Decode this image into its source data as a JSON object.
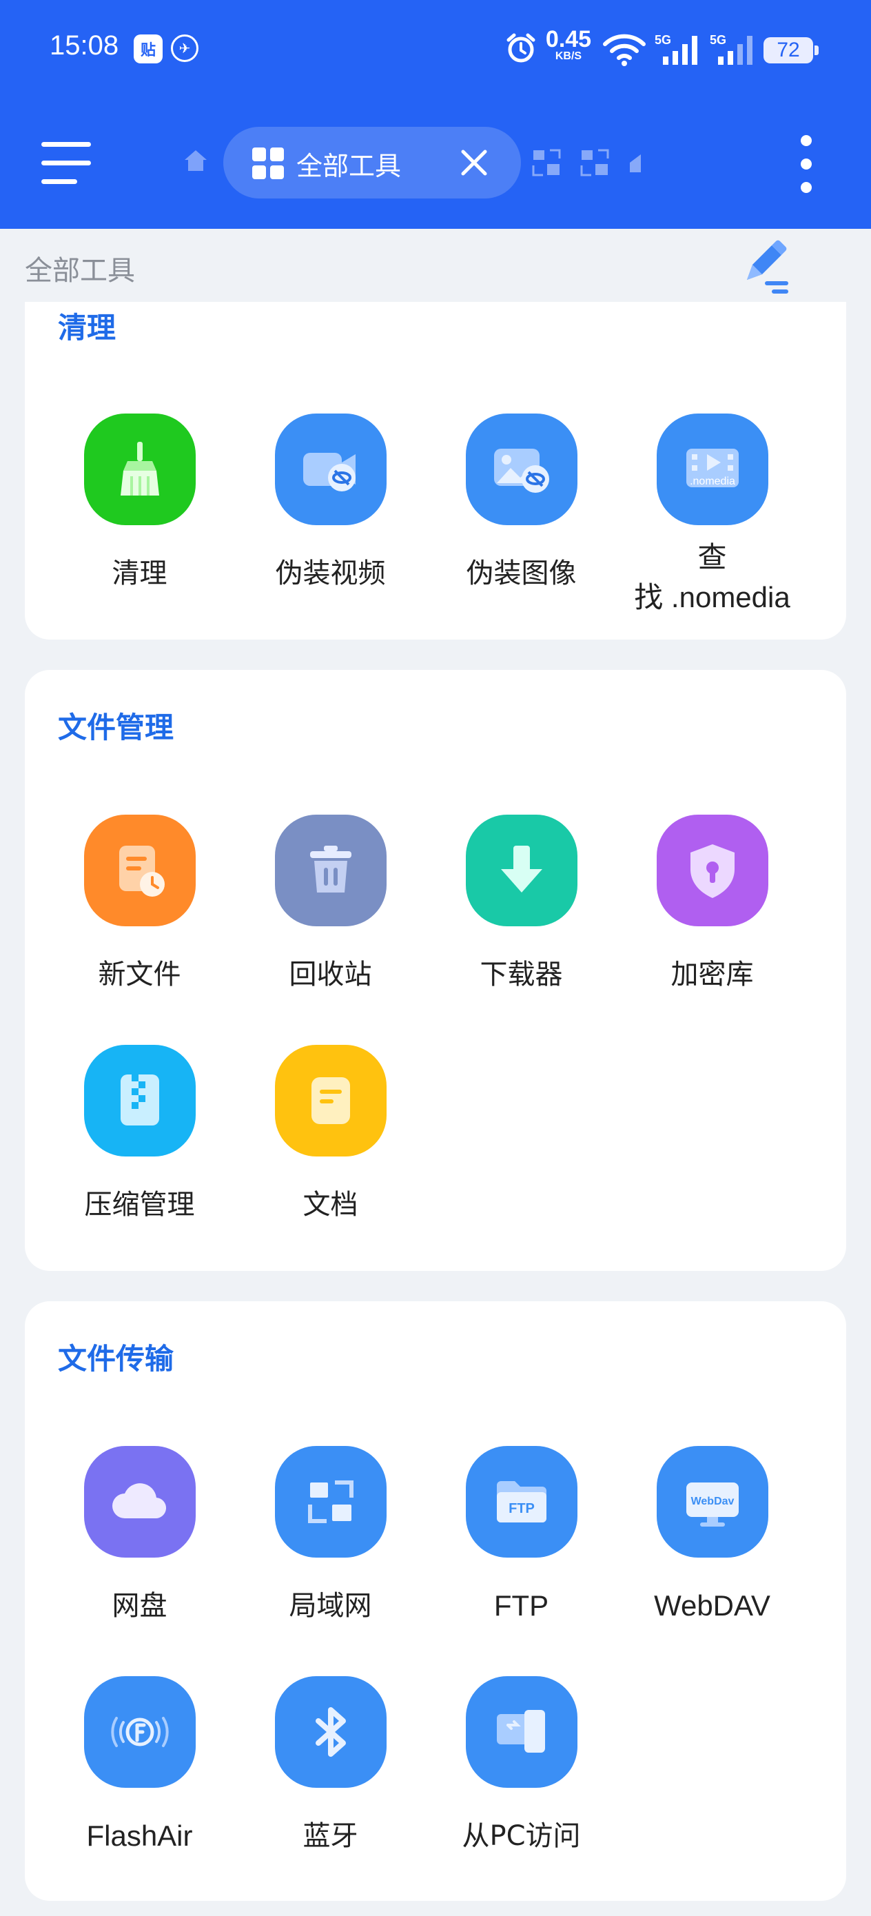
{
  "status_bar": {
    "time": "15:08",
    "app_badge": "贴",
    "net_speed_value": "0.45",
    "net_speed_unit": "KB/S",
    "signal1": "5G",
    "signal2": "5G",
    "battery": "72"
  },
  "nav": {
    "tab_label": "全部工具"
  },
  "subheader": {
    "title": "全部工具"
  },
  "sections": [
    {
      "title": "清理",
      "tools": [
        {
          "label": "清理",
          "icon": "broom-icon",
          "color": "#1fc91f"
        },
        {
          "label": "伪装视频",
          "icon": "video-hidden-icon",
          "color": "#3b8ff5"
        },
        {
          "label": "伪装图像",
          "icon": "image-hidden-icon",
          "color": "#3b8ff5"
        },
        {
          "label_line1": "查",
          "label_line2": "找 .nomedia",
          "icon": "nomedia-icon",
          "color": "#3b8ff5",
          "icon_text": ".nomedia"
        }
      ]
    },
    {
      "title": "文件管理",
      "tools": [
        {
          "label": "新文件",
          "icon": "recent-file-icon",
          "color": "#ff8a2a"
        },
        {
          "label": "回收站",
          "icon": "trash-icon",
          "color": "#7a8fc4"
        },
        {
          "label": "下载器",
          "icon": "download-icon",
          "color": "#19c9a7"
        },
        {
          "label": "加密库",
          "icon": "shield-lock-icon",
          "color": "#b05ff0"
        },
        {
          "label": "压缩管理",
          "icon": "zip-icon",
          "color": "#17b4f5"
        },
        {
          "label": "文档",
          "icon": "document-icon",
          "color": "#ffc20f"
        }
      ]
    },
    {
      "title": "文件传输",
      "tools": [
        {
          "label": "网盘",
          "icon": "cloud-icon",
          "color": "#7a72f2"
        },
        {
          "label": "局域网",
          "icon": "lan-icon",
          "color": "#3b8ff5"
        },
        {
          "label": "FTP",
          "icon": "ftp-folder-icon",
          "color": "#3b8ff5",
          "icon_text": "FTP"
        },
        {
          "label": "WebDAV",
          "icon": "webdav-icon",
          "color": "#3b8ff5",
          "icon_text": "WebDav"
        },
        {
          "label": "FlashAir",
          "icon": "flashair-icon",
          "color": "#3b8ff5"
        },
        {
          "label": "蓝牙",
          "icon": "bluetooth-icon",
          "color": "#3b8ff5"
        },
        {
          "label": "从PC访问",
          "icon": "pc-access-icon",
          "color": "#3b8ff5"
        }
      ]
    }
  ]
}
